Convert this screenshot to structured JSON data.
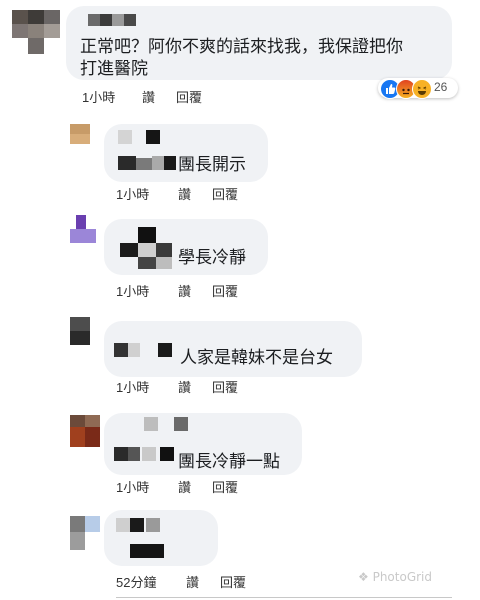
{
  "comments": [
    {
      "text_line1": "正常吧？阿你不爽的話來找我，我保證把你",
      "text_line2": "打進醫院",
      "time": "1小時",
      "like": "讚",
      "reply": "回覆",
      "reaction_count": "26"
    },
    {
      "text": "團長開示",
      "time": "1小時",
      "like": "讚",
      "reply": "回覆"
    },
    {
      "text": "學長冷靜",
      "time": "1小時",
      "like": "讚",
      "reply": "回覆"
    },
    {
      "text": "人家是韓妹不是台女",
      "time": "1小時",
      "like": "讚",
      "reply": "回覆"
    },
    {
      "text": "團長冷靜一點",
      "time": "1小時",
      "like": "讚",
      "reply": "回覆"
    },
    {
      "text": "",
      "time": "52分鐘",
      "like": "讚",
      "reply": "回覆"
    }
  ],
  "reactions": [
    "like-icon",
    "angry-icon",
    "haha-icon"
  ],
  "colors": {
    "bubble": "#f0f2f5",
    "like_blue": "#1877f2",
    "angry_red": "#e9710f",
    "haha_yellow": "#f7b125"
  },
  "watermark": "PhotoGrid"
}
